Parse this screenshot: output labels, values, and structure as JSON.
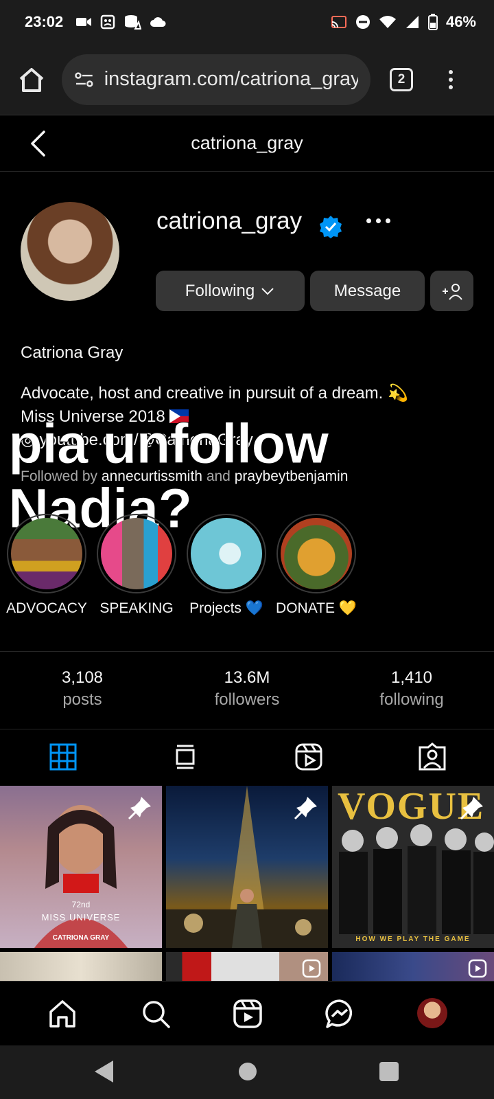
{
  "status_bar": {
    "time": "23:02",
    "left_icons": [
      "video-camera-icon",
      "gallery-icon",
      "data-saver-icon",
      "cloud-icon"
    ],
    "right_icons": [
      "cast-icon",
      "do-not-disturb-icon",
      "wifi-icon",
      "cell-signal-icon",
      "battery-icon"
    ],
    "battery": "46%"
  },
  "browser": {
    "url": "instagram.com/catriona_gray",
    "tab_count": "2"
  },
  "header": {
    "title": "catriona_gray"
  },
  "profile": {
    "username": "catriona_gray",
    "following_label": "Following",
    "message_label": "Message",
    "full_name": "Catriona Gray",
    "bio_line1": "Advocate, host and creative in pursuit of a dream. 💫",
    "bio_line2": "Miss Universe 2018",
    "bio_line3": "◎ youtube.com/@CatrionaGray",
    "followed_by_prefix": "Followed by",
    "followed_by_user1": "annecurtissmith",
    "followed_by_and": "and",
    "followed_by_user2": "praybeytbenjamin"
  },
  "overlay_caption": "pia unfollow Nadia?",
  "highlights": [
    {
      "label": "ADVOCACY"
    },
    {
      "label": "SPEAKING"
    },
    {
      "label": "Projects 💙"
    },
    {
      "label": "DONATE 💛"
    }
  ],
  "stats": {
    "posts_count": "3,108",
    "posts_label": "posts",
    "followers_count": "13.6M",
    "followers_label": "followers",
    "following_count": "1,410",
    "following_label": "following"
  },
  "posts": {
    "post1_text_top": "72nd",
    "post1_text_mid": "MISS UNIVERSE",
    "post1_text_name": "CATRIONA GRAY",
    "post3_title": "VOGUE",
    "post3_caption": "HOW WE PLAY THE GAME"
  },
  "colors": {
    "background": "#000000",
    "button_bg": "#363636",
    "accent_blue": "#0095f6",
    "muted_text": "#a8a8a8"
  }
}
